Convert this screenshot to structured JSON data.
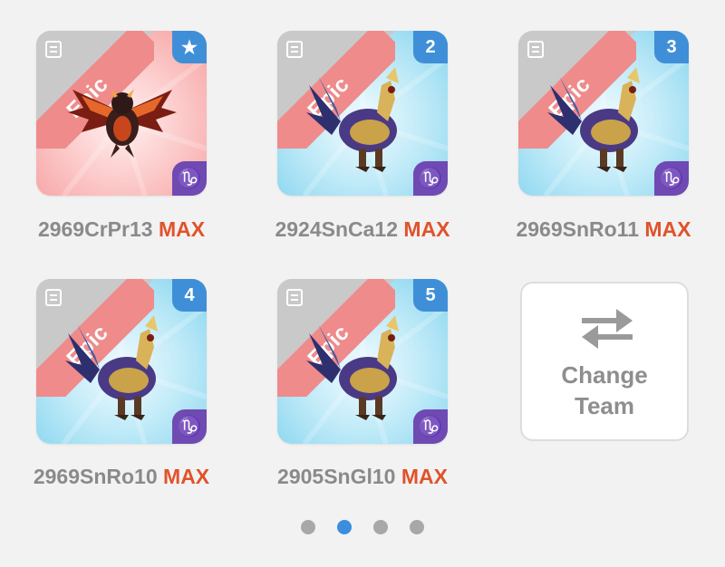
{
  "cards": [
    {
      "rarity": "Epic",
      "badge": "★",
      "element_symbol": "♑",
      "theme": "red",
      "name": "2969CrPr13",
      "level": "MAX",
      "creature": "red-dragon"
    },
    {
      "rarity": "Epic",
      "badge": "2",
      "element_symbol": "♑",
      "theme": "blue",
      "name": "2924SnCa12",
      "level": "MAX",
      "creature": "armored-bird"
    },
    {
      "rarity": "Epic",
      "badge": "3",
      "element_symbol": "♑",
      "theme": "blue",
      "name": "2969SnRo11",
      "level": "MAX",
      "creature": "armored-bird"
    },
    {
      "rarity": "Epic",
      "badge": "4",
      "element_symbol": "♑",
      "theme": "blue",
      "name": "2969SnRo10",
      "level": "MAX",
      "creature": "armored-bird"
    },
    {
      "rarity": "Epic",
      "badge": "5",
      "element_symbol": "♑",
      "theme": "blue",
      "name": "2905SnGl10",
      "level": "MAX",
      "creature": "armored-bird"
    }
  ],
  "change_team": {
    "line1": "Change",
    "line2": "Team",
    "icon": "swap-arrows-icon"
  },
  "pagination": {
    "total": 4,
    "active_index": 1
  },
  "colors": {
    "max": "#e0532a",
    "badge": "#3f8fd8",
    "element": "#6f4ab3",
    "ribbon": "#ef8b8b",
    "active_dot": "#3b8de0"
  }
}
